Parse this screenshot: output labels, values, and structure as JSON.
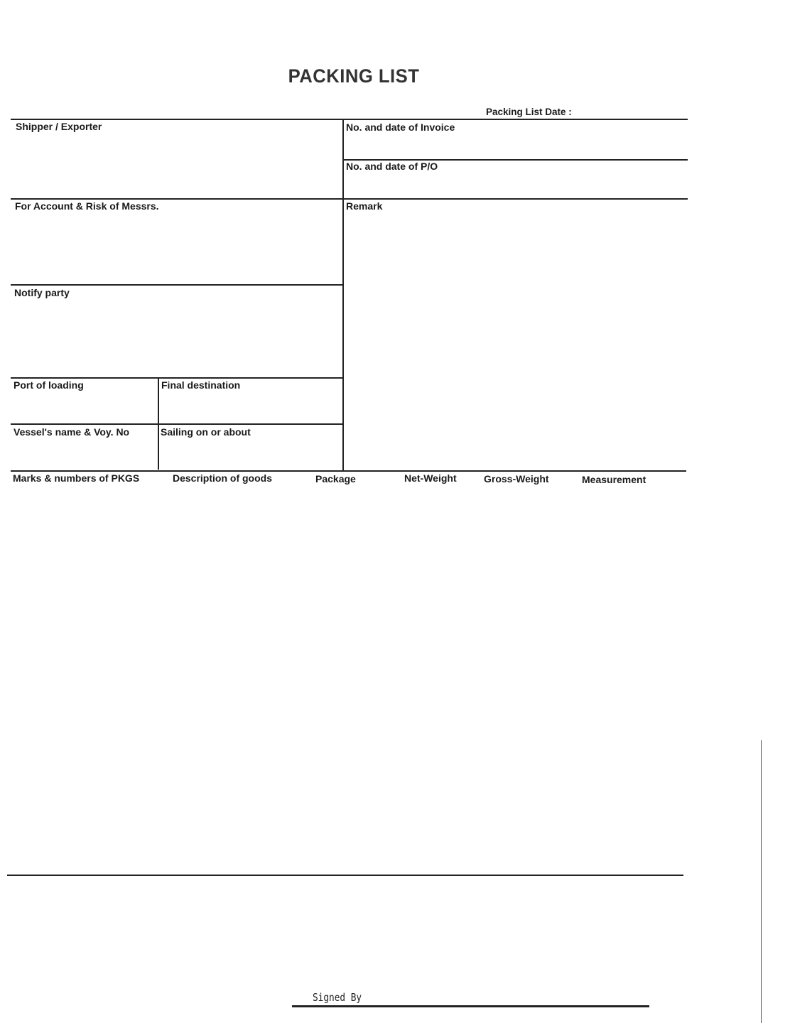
{
  "document": {
    "title": "PACKING LIST",
    "packing_list_date_label": "Packing List Date :",
    "packing_list_date_value": ""
  },
  "fields": {
    "shipper_exporter": {
      "label": "Shipper / Exporter",
      "value": ""
    },
    "invoice_no_date": {
      "label": "No. and date of Invoice",
      "value": ""
    },
    "po_no_date": {
      "label": "No. and date of P/O",
      "value": ""
    },
    "account_risk_messrs": {
      "label": "For Account & Risk of Messrs.",
      "value": ""
    },
    "remark": {
      "label": "Remark",
      "value": ""
    },
    "notify_party": {
      "label": "Notify party",
      "value": ""
    },
    "port_of_loading": {
      "label": "Port of loading",
      "value": ""
    },
    "final_destination": {
      "label": "Final destination",
      "value": ""
    },
    "vessel_voy": {
      "label": "Vessel's name & Voy. No",
      "value": ""
    },
    "sailing_on_or_about": {
      "label": "Sailing on or about",
      "value": ""
    }
  },
  "goods_table": {
    "columns": [
      "Marks & numbers of PKGS",
      "Description of goods",
      "Package",
      "Net-Weight",
      "Gross-Weight",
      "Measurement"
    ],
    "rows": []
  },
  "footer": {
    "signed_by_label": "Signed By",
    "signed_by_value": ""
  }
}
